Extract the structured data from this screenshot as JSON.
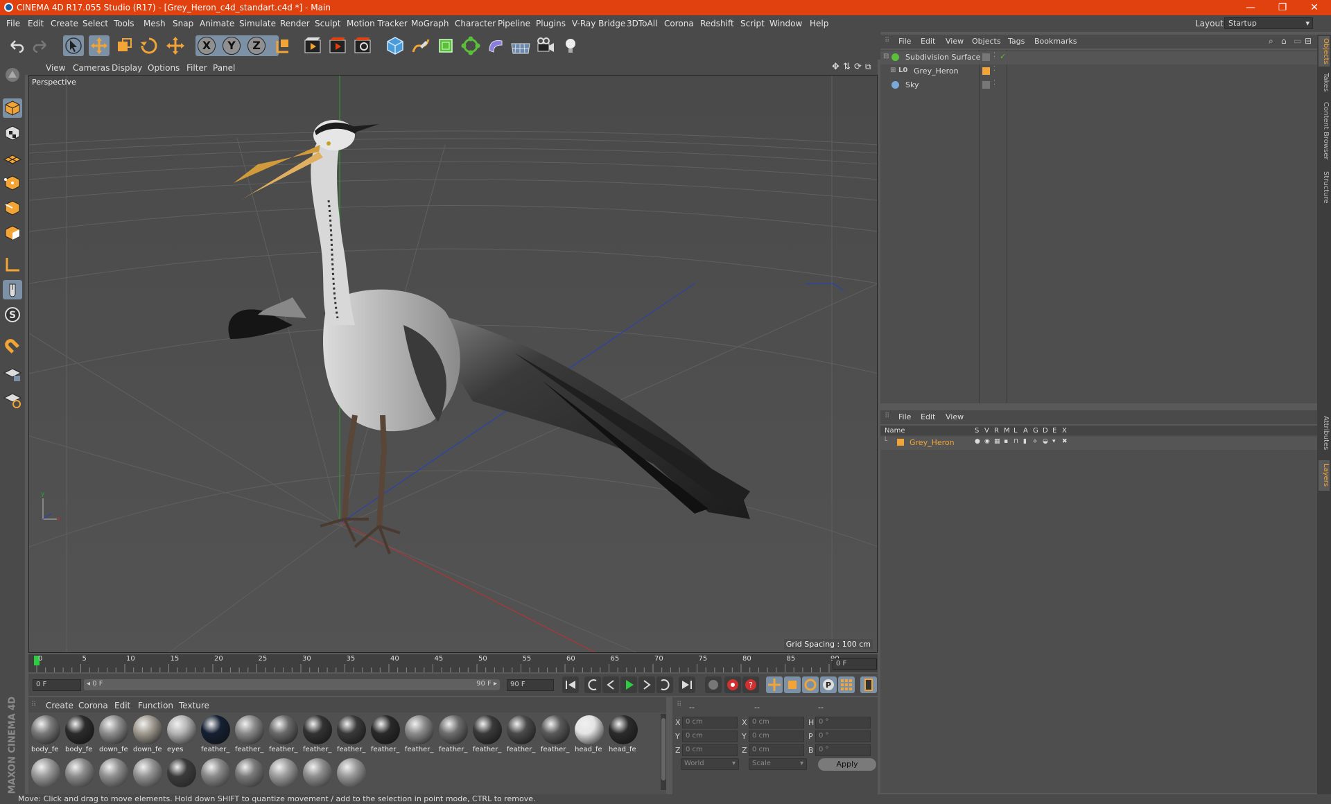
{
  "window": {
    "title": "CINEMA 4D R17.055 Studio (R17) - [Grey_Heron_c4d_standart.c4d *] - Main",
    "minimize": "—",
    "restore": "❐",
    "close": "✕"
  },
  "menubar": {
    "items": [
      "File",
      "Edit",
      "Create",
      "Select",
      "Tools",
      "Mesh",
      "Snap",
      "Animate",
      "Simulate",
      "Render",
      "Sculpt",
      "Motion Tracker",
      "MoGraph",
      "Character",
      "Pipeline",
      "Plugins",
      "V-Ray Bridge",
      "3DToAll",
      "Corona",
      "Redshift",
      "Script",
      "Window",
      "Help"
    ],
    "layout_label": "Layout:",
    "layout_value": "Startup"
  },
  "toolbar": {
    "x": "X",
    "y": "Y",
    "z": "Z",
    "icons": [
      "undo-icon",
      "redo-icon",
      "select-arrow-icon",
      "move-icon",
      "scale-icon",
      "rotate-icon",
      "live-select-icon",
      "x-axis-icon",
      "y-axis-icon",
      "z-axis-icon",
      "coordinate-system-icon",
      "render-view-icon",
      "render-picture-viewer-icon",
      "edit-render-settings-icon",
      "cube-icon",
      "pen-spline-icon",
      "subdivision-icon",
      "array-icon",
      "deformer-icon",
      "floor-icon",
      "camera-icon",
      "light-icon"
    ]
  },
  "viewport": {
    "menu": [
      "View",
      "Cameras",
      "Display",
      "Options",
      "Filter",
      "Panel"
    ],
    "label": "Perspective",
    "grid_spacing": "Grid Spacing : 100 cm"
  },
  "timeline": {
    "ticks": [
      "0",
      "5",
      "10",
      "15",
      "20",
      "25",
      "30",
      "35",
      "40",
      "45",
      "50",
      "55",
      "60",
      "65",
      "70",
      "75",
      "80",
      "85",
      "90"
    ],
    "current_frame": "0 F",
    "start_field": "0 F",
    "range_start": "◂ 0 F",
    "range_end": "90 F ▸",
    "end_field": "90 F"
  },
  "materials": {
    "menu": [
      "Create",
      "Corona",
      "Edit",
      "Function",
      "Texture"
    ],
    "row1": [
      {
        "label": "body_fe",
        "color": "#7a7a7a"
      },
      {
        "label": "body_fe",
        "color": "#2c2c2c"
      },
      {
        "label": "down_fe",
        "color": "#8e8e8e"
      },
      {
        "label": "down_fe",
        "color": "#a09a90"
      },
      {
        "label": "eyes",
        "color": "#b5b5b5"
      },
      {
        "label": "feather_",
        "color": "#142033"
      },
      {
        "label": "feather_",
        "color": "#8a8a8a"
      },
      {
        "label": "feather_",
        "color": "#6a6a6a"
      },
      {
        "label": "feather_",
        "color": "#333333"
      },
      {
        "label": "feather_",
        "color": "#3a3a3a"
      },
      {
        "label": "feather_",
        "color": "#2a2a2a"
      },
      {
        "label": "feather_",
        "color": "#8c8c8c"
      },
      {
        "label": "feather_",
        "color": "#6e6e6e"
      },
      {
        "label": "feather_",
        "color": "#3a3a3a"
      },
      {
        "label": "feather_",
        "color": "#4a4a4a"
      },
      {
        "label": "feather_",
        "color": "#5a5a5a"
      },
      {
        "label": "head_fe",
        "color": "#e4e4e4"
      },
      {
        "label": "head_fe",
        "color": "#2c2c2c"
      }
    ],
    "row2": [
      {
        "color": "#9a9a9a"
      },
      {
        "color": "#8c8c8c"
      },
      {
        "color": "#909090"
      },
      {
        "color": "#949494"
      },
      {
        "color": "#3a3a3a"
      },
      {
        "color": "#8a8a8a"
      },
      {
        "color": "#7a7a7a"
      },
      {
        "color": "#9c9c9c"
      },
      {
        "color": "#8e8e8e"
      },
      {
        "color": "#999999"
      }
    ]
  },
  "coords": {
    "headers": [
      "--",
      "--",
      "--"
    ],
    "rows": [
      {
        "a": "X",
        "av": "0 cm",
        "b": "X",
        "bv": "0 cm",
        "c": "H",
        "cv": "0 °"
      },
      {
        "a": "Y",
        "av": "0 cm",
        "b": "Y",
        "bv": "0 cm",
        "c": "P",
        "cv": "0 °"
      },
      {
        "a": "Z",
        "av": "0 cm",
        "b": "Z",
        "bv": "0 cm",
        "c": "B",
        "cv": "0 °"
      }
    ],
    "world": "World",
    "scale": "Scale",
    "apply": "Apply"
  },
  "object_manager": {
    "menu": [
      "File",
      "Edit",
      "View",
      "Objects",
      "Tags",
      "Bookmarks"
    ],
    "objects": [
      {
        "name": "Subdivision Surface"
      },
      {
        "name": "Grey_Heron"
      },
      {
        "name": "Sky"
      }
    ]
  },
  "layer_manager": {
    "menu": [
      "File",
      "Edit",
      "View"
    ],
    "columns": [
      "Name",
      "S",
      "V",
      "R",
      "M",
      "L",
      "A",
      "G",
      "D",
      "E",
      "X"
    ],
    "layers": [
      {
        "name": "Grey_Heron",
        "color": "#f2a536"
      }
    ]
  },
  "right_tabs": [
    "Objects",
    "Takes",
    "Content Browser",
    "Structure",
    "Attributes",
    "Layers"
  ],
  "brand": "MAXON CINEMA 4D",
  "status": "Move: Click and drag to move elements. Hold down SHIFT to quantize movement / add to the selection in point mode, CTRL to remove."
}
